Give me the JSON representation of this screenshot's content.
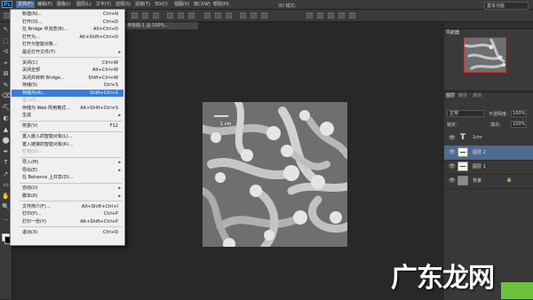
{
  "app": {
    "logo": "Ps"
  },
  "menubar": {
    "items": [
      "文件(F)",
      "编辑(E)",
      "图像(I)",
      "图层(L)",
      "文字(Y)",
      "选择(S)",
      "滤镜(T)",
      "3D(D)",
      "视图(V)",
      "窗口(W)",
      "帮助(H)"
    ],
    "window_controls": "─ □ ✕"
  },
  "options": {
    "mode_3d": "3D 模式:",
    "workspace": "基本功能"
  },
  "document": {
    "tab_label": "未标题-1 @ 100%..."
  },
  "file_menu": {
    "items": [
      {
        "label": "新建(N)...",
        "shortcut": "Ctrl+N"
      },
      {
        "label": "打开(O)...",
        "shortcut": "Ctrl+O"
      },
      {
        "label": "在 Bridge 中浏览(B)...",
        "shortcut": "Alt+Ctrl+O"
      },
      {
        "label": "打开为...",
        "shortcut": "Alt+Shift+Ctrl+O"
      },
      {
        "label": "打开为智能对象...",
        "shortcut": ""
      },
      {
        "label": "最近打开文件(T)",
        "shortcut": "",
        "submenu": true
      },
      {
        "label": "关闭(C)",
        "shortcut": "Ctrl+W"
      },
      {
        "label": "关闭全部",
        "shortcut": "Alt+Ctrl+W"
      },
      {
        "label": "关闭并转到 Bridge...",
        "shortcut": "Shift+Ctrl+W"
      },
      {
        "label": "存储(S)",
        "shortcut": "Ctrl+S"
      },
      {
        "label": "存储为(A)...",
        "shortcut": "Shift+Ctrl+S",
        "highlighted": true
      },
      {
        "label": "签入(I)...",
        "shortcut": "",
        "disabled": true
      },
      {
        "label": "存储为 Web 所用格式...",
        "shortcut": "Alt+Shift+Ctrl+S"
      },
      {
        "label": "生成",
        "shortcut": "",
        "submenu": true
      },
      {
        "label": "恢复(V)",
        "shortcut": "F12"
      },
      {
        "label": "置入嵌入的智能对象(L)...",
        "shortcut": ""
      },
      {
        "label": "置入链接的智能对象(K)...",
        "shortcut": ""
      },
      {
        "label": "打包(G)...",
        "shortcut": "",
        "disabled": true
      },
      {
        "label": "导入(M)",
        "shortcut": "",
        "submenu": true
      },
      {
        "label": "导出(E)",
        "shortcut": "",
        "submenu": true
      },
      {
        "label": "在 Behance 上共享(D)...",
        "shortcut": ""
      },
      {
        "label": "自动(U)",
        "shortcut": "",
        "submenu": true
      },
      {
        "label": "脚本(R)",
        "shortcut": "",
        "submenu": true
      },
      {
        "label": "文件简介(F)...",
        "shortcut": "Alt+Shift+Ctrl+I"
      },
      {
        "label": "打印(P)...",
        "shortcut": "Ctrl+P"
      },
      {
        "label": "打印一份(Y)",
        "shortcut": "Alt+Shift+Ctrl+P"
      },
      {
        "label": "退出(X)",
        "shortcut": "Ctrl+Q"
      }
    ],
    "submenu_arrow": "▸"
  },
  "navigator": {
    "tab": "导航器"
  },
  "layers": {
    "tabs": [
      "图层",
      "路径",
      "通道"
    ],
    "blend_mode": "正常",
    "opacity_label": "不透明度:",
    "opacity_value": "100%",
    "lock_label": "锁定:",
    "fill_label": "填充:",
    "fill_value": "100%",
    "rows": [
      {
        "name": "1cm",
        "kind": "text",
        "thumb": "T"
      },
      {
        "name": "图层 2",
        "kind": "line",
        "selected": true
      },
      {
        "name": "图层 1",
        "kind": "line"
      },
      {
        "name": "背景",
        "kind": "image",
        "lock": "🔒"
      }
    ],
    "eye": "👁"
  },
  "toolbar": {
    "tools": [
      "↖",
      "⬚",
      "ᐊ",
      "⌖",
      "⊠",
      "✎",
      "⌫",
      "⛏",
      "◐",
      "▲",
      "⬤",
      "✒",
      "T",
      "➚",
      "▭",
      "✋",
      "🔍",
      "…"
    ]
  },
  "canvas": {
    "scale_label": "1 cm"
  },
  "watermark": {
    "text": "广东龙网"
  },
  "colors": {
    "menu_highlight": "#3a7bd5",
    "selected_layer": "#4d6a8f",
    "nav_frame": "#d03030"
  }
}
